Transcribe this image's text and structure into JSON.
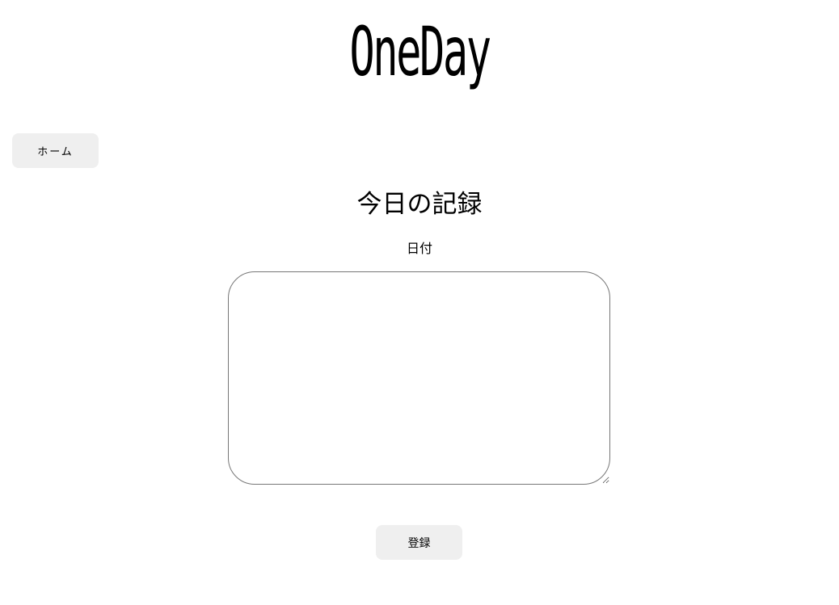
{
  "header": {
    "logo_text": "OneDay"
  },
  "nav": {
    "home_label": "ホーム"
  },
  "main": {
    "title": "今日の記録",
    "date_label": "日付",
    "entry": {
      "value": "",
      "placeholder": ""
    },
    "submit_label": "登録"
  },
  "colors": {
    "background": "#ffffff",
    "button_background": "#efefef",
    "textarea_border": "#767676",
    "text": "#000000"
  }
}
